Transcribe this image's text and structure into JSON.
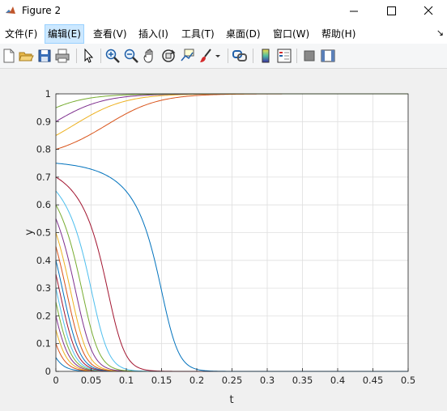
{
  "window": {
    "title": "Figure 2"
  },
  "menu": [
    {
      "label": "文件(F)"
    },
    {
      "label": "编辑(E)"
    },
    {
      "label": "查看(V)"
    },
    {
      "label": "插入(I)"
    },
    {
      "label": "工具(T)"
    },
    {
      "label": "桌面(D)"
    },
    {
      "label": "窗口(W)"
    },
    {
      "label": "帮助(H)"
    }
  ],
  "toolbar_icons": [
    "new-figure-icon",
    "open-file-icon",
    "save-icon",
    "print-icon",
    "pointer-icon",
    "zoom-in-icon",
    "zoom-out-icon",
    "pan-icon",
    "rotate-3d-icon",
    "data-cursor-icon",
    "brush-icon",
    "brush-dropdown-icon",
    "link-plot-icon",
    "colorbar-icon",
    "legend-icon",
    "hide-plot-tools-icon",
    "show-plot-tools-icon"
  ],
  "chart_data": {
    "type": "line",
    "xlabel": "t",
    "ylabel": "y",
    "xlim": [
      0,
      0.5
    ],
    "ylim": [
      0,
      1
    ],
    "grid": true,
    "x_ticks": [
      "0",
      "0.05",
      "0.1",
      "0.15",
      "0.2",
      "0.25",
      "0.3",
      "0.35",
      "0.4",
      "0.45",
      "0.5"
    ],
    "y_ticks": [
      "0",
      "0.1",
      "0.2",
      "0.3",
      "0.4",
      "0.5",
      "0.6",
      "0.7",
      "0.8",
      "0.9",
      "1"
    ],
    "initial_values": [
      0.05,
      0.1,
      0.15,
      0.2,
      0.25,
      0.3,
      0.35,
      0.4,
      0.45,
      0.5,
      0.55,
      0.6,
      0.65,
      0.7,
      0.75,
      0.8,
      0.85,
      0.9,
      0.95
    ],
    "colors": [
      "#0072bd",
      "#d95319",
      "#edb120",
      "#7e2f8e",
      "#77ac30",
      "#4dbeee",
      "#a2142f"
    ]
  }
}
